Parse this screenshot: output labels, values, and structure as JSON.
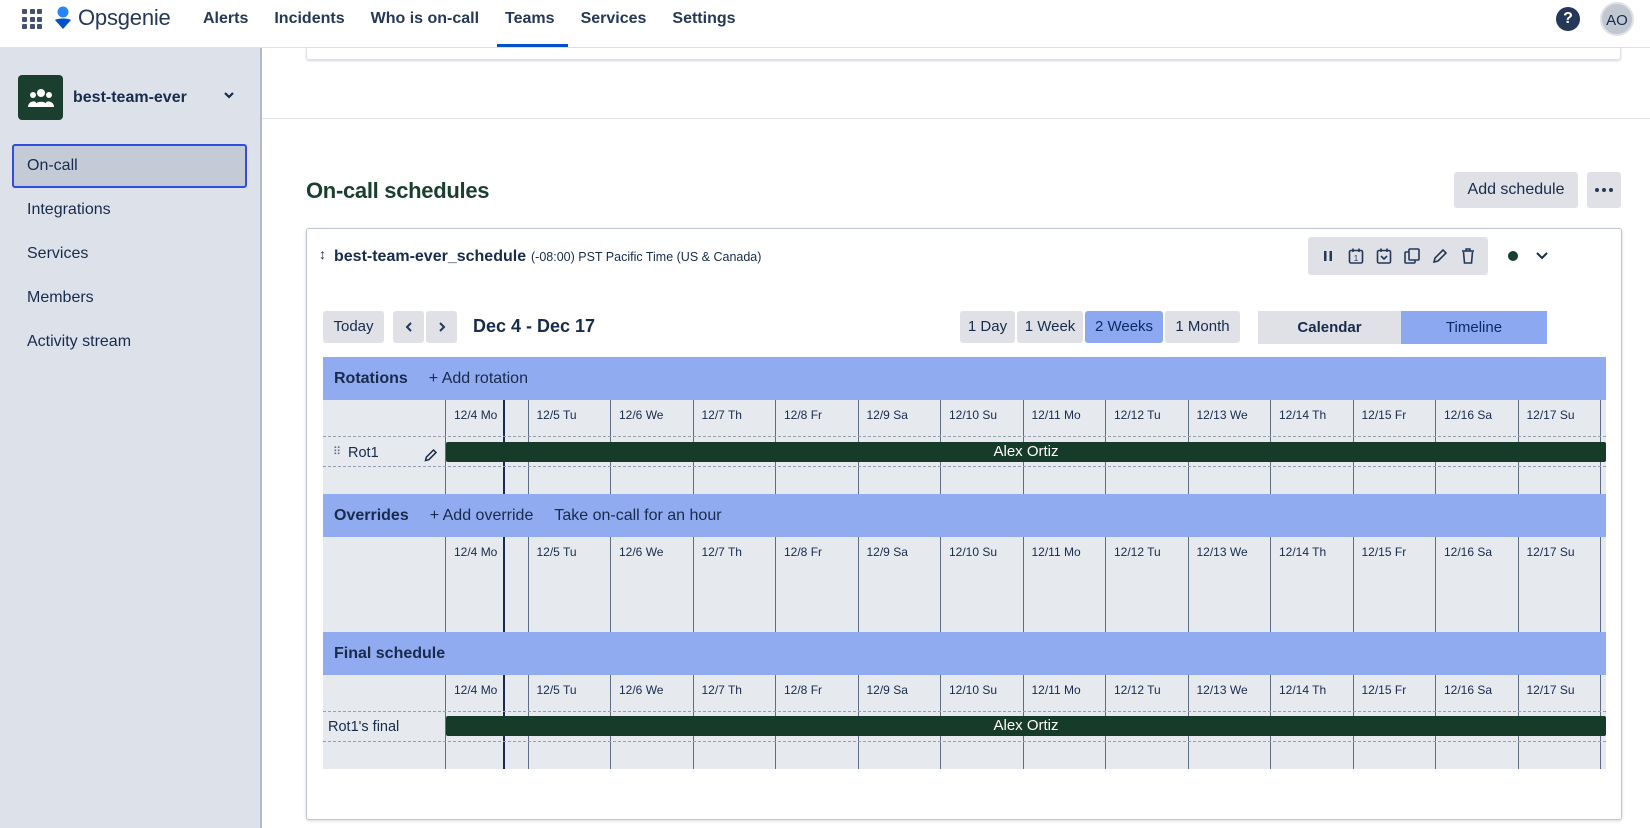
{
  "topnav": {
    "brand": "Opsgenie",
    "items": [
      {
        "label": "Alerts"
      },
      {
        "label": "Incidents"
      },
      {
        "label": "Who is on-call"
      },
      {
        "label": "Teams",
        "active": true
      },
      {
        "label": "Services"
      },
      {
        "label": "Settings"
      }
    ],
    "help_label": "?",
    "avatar_initials": "AO"
  },
  "sidebar": {
    "team_name": "best-team-ever",
    "items": [
      {
        "label": "On-call",
        "active": true
      },
      {
        "label": "Integrations"
      },
      {
        "label": "Services"
      },
      {
        "label": "Members"
      },
      {
        "label": "Activity stream"
      }
    ]
  },
  "main": {
    "section_title": "On-call schedules",
    "add_schedule_label": "Add schedule",
    "schedule": {
      "name": "best-team-ever_schedule",
      "timezone": "(-08:00) PST Pacific Time (US & Canada)",
      "toolbar_icons": [
        "pause-icon",
        "calendar-icon",
        "calendar-swap-icon",
        "copy-icon",
        "edit-icon",
        "delete-icon"
      ],
      "status_color": "#1a3f2e",
      "today_label": "Today",
      "date_range": "Dec 4 - Dec 17",
      "ranges": [
        {
          "label": "1 Day"
        },
        {
          "label": "1 Week"
        },
        {
          "label": "2 Weeks",
          "selected": true
        },
        {
          "label": "1 Month"
        }
      ],
      "views": [
        {
          "label": "Calendar"
        },
        {
          "label": "Timeline",
          "selected": true
        }
      ],
      "days": [
        "12/4 Mo",
        "12/5 Tu",
        "12/6 We",
        "12/7 Th",
        "12/8 Fr",
        "12/9 Sa",
        "12/10 Su",
        "12/11 Mo",
        "12/12 Tu",
        "12/13 We",
        "12/14 Th",
        "12/15 Fr",
        "12/16 Sa",
        "12/17 Su"
      ],
      "rotations": {
        "title": "Rotations",
        "add_label": "+ Add rotation",
        "rows": [
          {
            "name": "Rot1",
            "assignee": "Alex Ortiz"
          }
        ]
      },
      "overrides": {
        "title": "Overrides",
        "add_label": "+ Add override",
        "take_label": "Take on-call for an hour"
      },
      "final": {
        "title": "Final schedule",
        "rows": [
          {
            "name": "Rot1's final",
            "assignee": "Alex Ortiz"
          }
        ]
      }
    }
  },
  "colors": {
    "accent_blue": "#0052cc",
    "band_blue": "#91abf0",
    "oncall_bar": "#163b28"
  }
}
